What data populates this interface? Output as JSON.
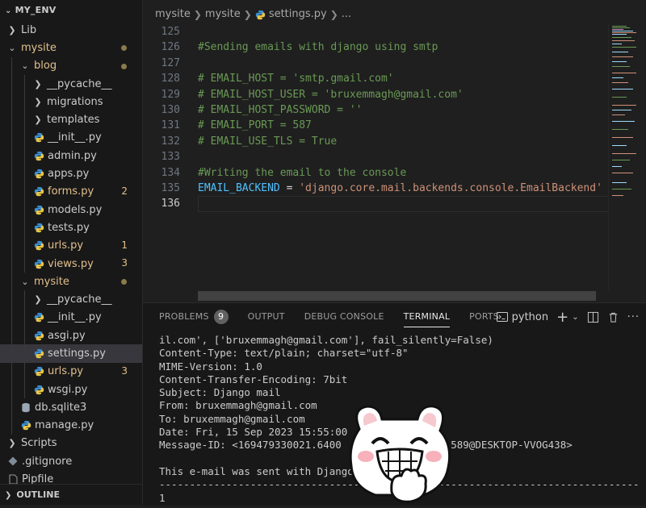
{
  "sidebar": {
    "root": "MY_ENV",
    "items": [
      {
        "label": "Lib",
        "indent": 1,
        "type": "folder-collapsed"
      },
      {
        "label": "mysite",
        "indent": 1,
        "type": "folder-open",
        "modified": true,
        "dot": true
      },
      {
        "label": "blog",
        "indent": 2,
        "type": "folder-open",
        "modified": true,
        "dot": true
      },
      {
        "label": "__pycache__",
        "indent": 3,
        "type": "folder-collapsed"
      },
      {
        "label": "migrations",
        "indent": 3,
        "type": "folder-collapsed"
      },
      {
        "label": "templates",
        "indent": 3,
        "type": "folder-collapsed"
      },
      {
        "label": "__init__.py",
        "indent": 3,
        "type": "py"
      },
      {
        "label": "admin.py",
        "indent": 3,
        "type": "py"
      },
      {
        "label": "apps.py",
        "indent": 3,
        "type": "py"
      },
      {
        "label": "forms.py",
        "indent": 3,
        "type": "py",
        "modified": true,
        "badge": "2"
      },
      {
        "label": "models.py",
        "indent": 3,
        "type": "py"
      },
      {
        "label": "tests.py",
        "indent": 3,
        "type": "py"
      },
      {
        "label": "urls.py",
        "indent": 3,
        "type": "py",
        "modified": true,
        "badge": "1"
      },
      {
        "label": "views.py",
        "indent": 3,
        "type": "py",
        "modified": true,
        "badge": "3"
      },
      {
        "label": "mysite",
        "indent": 2,
        "type": "folder-open",
        "modified": true,
        "dot": true
      },
      {
        "label": "__pycache__",
        "indent": 3,
        "type": "folder-collapsed"
      },
      {
        "label": "__init__.py",
        "indent": 3,
        "type": "py"
      },
      {
        "label": "asgi.py",
        "indent": 3,
        "type": "py"
      },
      {
        "label": "settings.py",
        "indent": 3,
        "type": "py",
        "selected": true
      },
      {
        "label": "urls.py",
        "indent": 3,
        "type": "py",
        "modified": true,
        "badge": "3"
      },
      {
        "label": "wsgi.py",
        "indent": 3,
        "type": "py"
      },
      {
        "label": "db.sqlite3",
        "indent": 2,
        "type": "db"
      },
      {
        "label": "manage.py",
        "indent": 2,
        "type": "py"
      },
      {
        "label": "Scripts",
        "indent": 1,
        "type": "folder-collapsed"
      },
      {
        "label": ".gitignore",
        "indent": 1,
        "type": "git"
      },
      {
        "label": "Pipfile",
        "indent": 1,
        "type": "file"
      }
    ],
    "outline": "OUTLINE"
  },
  "editor": {
    "breadcrumb": [
      "mysite",
      "mysite",
      "settings.py",
      "..."
    ],
    "lines": [
      {
        "n": "125",
        "parts": []
      },
      {
        "n": "126",
        "parts": [
          {
            "c": "c-comment",
            "t": "#Sending emails with django using smtp"
          }
        ]
      },
      {
        "n": "127",
        "parts": []
      },
      {
        "n": "128",
        "parts": [
          {
            "c": "c-comment",
            "t": "# EMAIL_HOST = 'smtp.gmail.com'"
          }
        ]
      },
      {
        "n": "129",
        "parts": [
          {
            "c": "c-comment",
            "t": "# EMAIL_HOST_USER = 'bruxemmagh@gmail.com'"
          }
        ]
      },
      {
        "n": "130",
        "parts": [
          {
            "c": "c-comment",
            "t": "# EMAIL_HOST_PASSWORD = ''"
          }
        ]
      },
      {
        "n": "131",
        "parts": [
          {
            "c": "c-comment",
            "t": "# EMAIL_PORT = 587"
          }
        ]
      },
      {
        "n": "132",
        "parts": [
          {
            "c": "c-comment",
            "t": "# EMAIL_USE_TLS = True"
          }
        ]
      },
      {
        "n": "133",
        "parts": []
      },
      {
        "n": "134",
        "parts": [
          {
            "c": "c-comment",
            "t": "#Writing the email to the console"
          }
        ]
      },
      {
        "n": "135",
        "parts": [
          {
            "c": "c-var",
            "t": "EMAIL_BACKEND"
          },
          {
            "c": "c-op",
            "t": " = "
          },
          {
            "c": "c-str",
            "t": "'django.core.mail.backends.console.EmailBackend'"
          }
        ]
      },
      {
        "n": "136",
        "parts": [],
        "active": true
      }
    ]
  },
  "panel": {
    "tabs": {
      "problems": "PROBLEMS",
      "problems_count": "9",
      "output": "OUTPUT",
      "debug": "DEBUG CONSOLE",
      "terminal": "TERMINAL",
      "ports": "PORTS"
    },
    "terminal_name": "python",
    "terminal_lines": [
      "il.com', ['bruxemmagh@gmail.com'], fail_silently=False)",
      "Content-Type: text/plain; charset=\"utf-8\"",
      "MIME-Version: 1.0",
      "Content-Transfer-Encoding: 7bit",
      "Subject: Django mail",
      "From: bruxemmagh@gmail.com",
      "To: bruxemmagh@gmail.com",
      "Date: Fri, 15 Sep 2023 15:55:00",
      "Message-ID: <169479330021.6400                  589@DESKTOP-VVOG438>",
      "",
      "This e-mail was sent with Django",
      "-------------------------------------------------------------------------------",
      "1"
    ]
  },
  "colors": {
    "modified": "#e2c08d",
    "comment": "#6a9955",
    "string": "#ce9178",
    "variable": "#4fc1ff"
  }
}
